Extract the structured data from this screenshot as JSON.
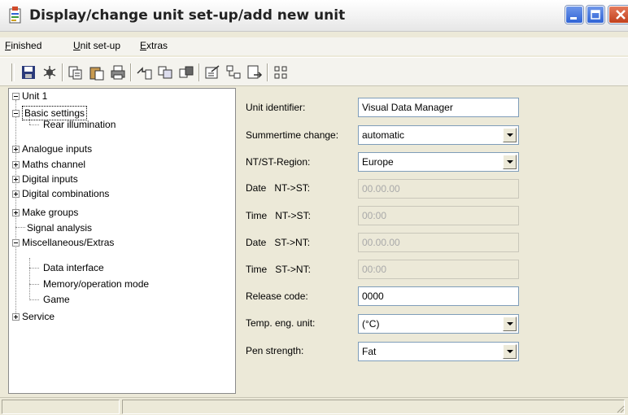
{
  "window": {
    "title": "Display/change unit set-up/add new unit"
  },
  "menu": {
    "items": [
      {
        "prefix": "",
        "accel": "F",
        "rest": "inished"
      },
      {
        "prefix": "",
        "accel": "U",
        "rest": "nit set-up"
      },
      {
        "prefix": "",
        "accel": "E",
        "rest": "xtras"
      }
    ]
  },
  "toolbar": {
    "icons": [
      "save-icon",
      "bug-icon",
      "copy-icon",
      "paste-icon",
      "print-icon",
      "transfer-icon",
      "compare-icon",
      "link-icon",
      "properties-icon",
      "network-icon",
      "export-icon",
      "grid-icon"
    ]
  },
  "tree": {
    "items": [
      {
        "label": "Unit 1",
        "expander": "minus"
      },
      {
        "label": "Basic settings",
        "expander": "minus"
      },
      {
        "label": "Rear illumination",
        "expander": "none"
      },
      {
        "label": "Analogue inputs",
        "expander": "plus"
      },
      {
        "label": "Maths channel",
        "expander": "plus"
      },
      {
        "label": "Digital inputs",
        "expander": "plus"
      },
      {
        "label": "Digital combinations",
        "expander": "plus"
      },
      {
        "label": "Make groups",
        "expander": "plus"
      },
      {
        "label": "Signal analysis",
        "expander": "none"
      },
      {
        "label": "Miscellaneous/Extras",
        "expander": "minus"
      },
      {
        "label": "Data interface",
        "expander": "none"
      },
      {
        "label": "Memory/operation mode",
        "expander": "none"
      },
      {
        "label": "Game",
        "expander": "none"
      },
      {
        "label": "Service",
        "expander": "plus"
      }
    ],
    "selected": "Basic settings"
  },
  "form": {
    "unit_identifier": {
      "label": "Unit identifier:",
      "value": "Visual Data Manager"
    },
    "summertime_change": {
      "label": "Summertime change:",
      "value": "automatic"
    },
    "nt_st_region": {
      "label": "NT/ST-Region:",
      "value": "Europe"
    },
    "date_nt_st": {
      "label": "Date   NT->ST:",
      "value": "00.00.00"
    },
    "time_nt_st": {
      "label": "Time   NT->ST:",
      "value": "00:00"
    },
    "date_st_nt": {
      "label": "Date   ST->NT:",
      "value": "00.00.00"
    },
    "time_st_nt": {
      "label": "Time   ST->NT:",
      "value": "00:00"
    },
    "release_code": {
      "label": "Release code:",
      "value": "0000"
    },
    "temp_eng_unit": {
      "label": "Temp. eng. unit:",
      "value": "(°C)"
    },
    "pen_strength": {
      "label": "Pen strength:",
      "value": "Fat"
    }
  },
  "colors": {
    "titlebar": "#f2f2f2",
    "dialog_face": "#ece9d8",
    "field_border": "#7f9db9",
    "close_button": "#c1401d",
    "window_button": "#2f63d6"
  }
}
